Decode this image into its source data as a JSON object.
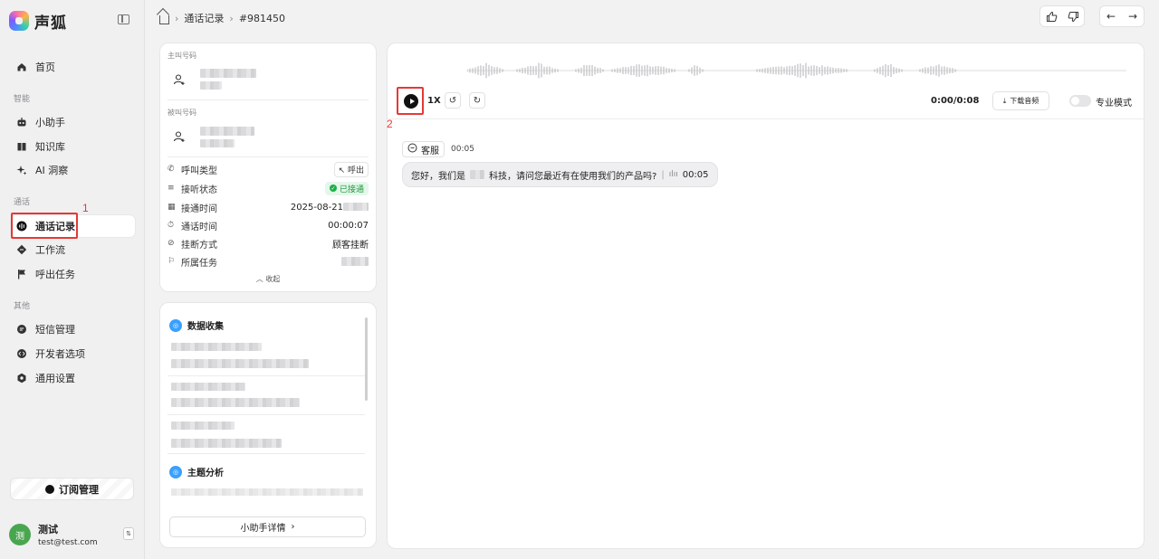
{
  "brand": {
    "name": "声狐"
  },
  "sidebar": {
    "home": "首页",
    "group_smart": "智能",
    "assistant": "小助手",
    "knowledge": "知识库",
    "ai_insight": "AI 洞察",
    "group_call": "通话",
    "call_records": "通话记录",
    "workflow": "工作流",
    "outbound_task": "呼出任务",
    "group_other": "其他",
    "sms": "短信管理",
    "developer": "开发者选项",
    "settings": "通用设置",
    "subscribe": "订阅管理"
  },
  "user": {
    "avatar": "测",
    "name": "测试",
    "email": "test@test.com"
  },
  "annotations": {
    "one": "1",
    "two": "2"
  },
  "breadcrumb": {
    "page": "通话记录",
    "record_id": "#981450"
  },
  "call_info": {
    "caller_label": "主叫号码",
    "callee_label": "被叫号码",
    "rows": [
      {
        "label": "呼叫类型",
        "value": "呼出"
      },
      {
        "label": "接听状态",
        "value": "已接通"
      },
      {
        "label": "接通时间",
        "value": "2025-08-21"
      },
      {
        "label": "通话时间",
        "value": "00:00:07"
      },
      {
        "label": "挂断方式",
        "value": "顾客挂断"
      },
      {
        "label": "所属任务",
        "value": ""
      }
    ],
    "collapse": "收起"
  },
  "analysis": {
    "data_collection": "数据收集",
    "topic_analysis": "主题分析",
    "detail_button": "小助手详情"
  },
  "player": {
    "speed": "1X",
    "time": "0:00/0:08",
    "download": "下载音频",
    "pro_mode": "专业模式"
  },
  "transcript": {
    "speaker": "客服",
    "timestamp": "00:05",
    "text_before": "您好，我们是",
    "text_after": "科技，请问您最近有在使用我们的产品吗?",
    "audio_time": "00:05"
  }
}
